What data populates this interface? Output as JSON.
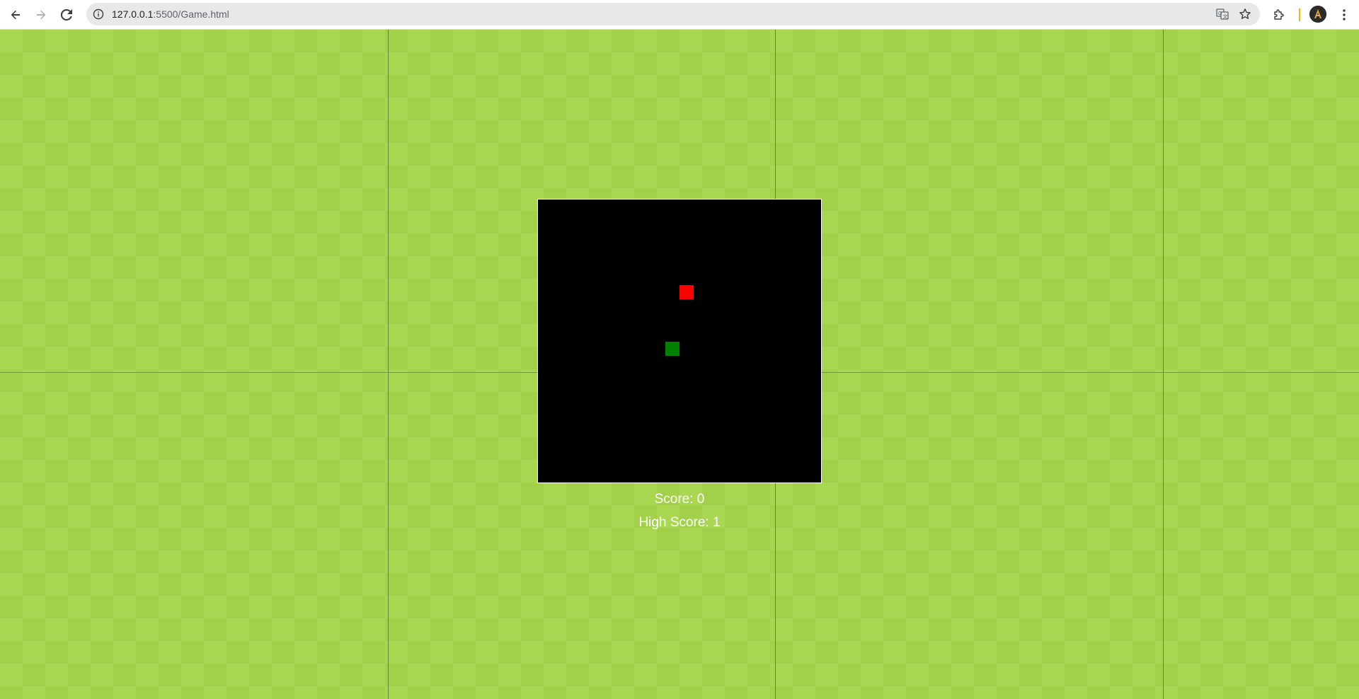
{
  "browser": {
    "url_host": "127.0.0.1",
    "url_path": ":5500/Game.html",
    "icons": [
      "back-icon",
      "forward-icon",
      "reload-icon",
      "site-info-icon",
      "translate-icon",
      "bookmark-star-icon",
      "extensions-icon",
      "profile-avatar",
      "menu-kebab-icon"
    ]
  },
  "game": {
    "score_label": "Score: 0",
    "high_score_label": "High Score: 1",
    "colors": {
      "board": "#000000",
      "food": "#ff0000",
      "snake": "#008000",
      "grass_light": "#a9d751",
      "grass_dark": "#a2d149",
      "text": "#ffffff"
    }
  }
}
